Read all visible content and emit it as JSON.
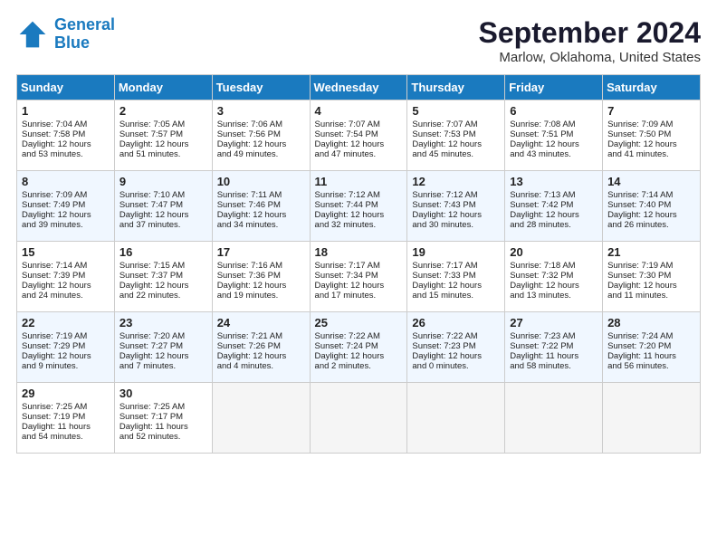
{
  "header": {
    "logo_line1": "General",
    "logo_line2": "Blue",
    "title": "September 2024",
    "subtitle": "Marlow, Oklahoma, United States"
  },
  "columns": [
    "Sunday",
    "Monday",
    "Tuesday",
    "Wednesday",
    "Thursday",
    "Friday",
    "Saturday"
  ],
  "weeks": [
    [
      {
        "day": "1",
        "info": "Sunrise: 7:04 AM\nSunset: 7:58 PM\nDaylight: 12 hours\nand 53 minutes."
      },
      {
        "day": "2",
        "info": "Sunrise: 7:05 AM\nSunset: 7:57 PM\nDaylight: 12 hours\nand 51 minutes."
      },
      {
        "day": "3",
        "info": "Sunrise: 7:06 AM\nSunset: 7:56 PM\nDaylight: 12 hours\nand 49 minutes."
      },
      {
        "day": "4",
        "info": "Sunrise: 7:07 AM\nSunset: 7:54 PM\nDaylight: 12 hours\nand 47 minutes."
      },
      {
        "day": "5",
        "info": "Sunrise: 7:07 AM\nSunset: 7:53 PM\nDaylight: 12 hours\nand 45 minutes."
      },
      {
        "day": "6",
        "info": "Sunrise: 7:08 AM\nSunset: 7:51 PM\nDaylight: 12 hours\nand 43 minutes."
      },
      {
        "day": "7",
        "info": "Sunrise: 7:09 AM\nSunset: 7:50 PM\nDaylight: 12 hours\nand 41 minutes."
      }
    ],
    [
      {
        "day": "8",
        "info": "Sunrise: 7:09 AM\nSunset: 7:49 PM\nDaylight: 12 hours\nand 39 minutes."
      },
      {
        "day": "9",
        "info": "Sunrise: 7:10 AM\nSunset: 7:47 PM\nDaylight: 12 hours\nand 37 minutes."
      },
      {
        "day": "10",
        "info": "Sunrise: 7:11 AM\nSunset: 7:46 PM\nDaylight: 12 hours\nand 34 minutes."
      },
      {
        "day": "11",
        "info": "Sunrise: 7:12 AM\nSunset: 7:44 PM\nDaylight: 12 hours\nand 32 minutes."
      },
      {
        "day": "12",
        "info": "Sunrise: 7:12 AM\nSunset: 7:43 PM\nDaylight: 12 hours\nand 30 minutes."
      },
      {
        "day": "13",
        "info": "Sunrise: 7:13 AM\nSunset: 7:42 PM\nDaylight: 12 hours\nand 28 minutes."
      },
      {
        "day": "14",
        "info": "Sunrise: 7:14 AM\nSunset: 7:40 PM\nDaylight: 12 hours\nand 26 minutes."
      }
    ],
    [
      {
        "day": "15",
        "info": "Sunrise: 7:14 AM\nSunset: 7:39 PM\nDaylight: 12 hours\nand 24 minutes."
      },
      {
        "day": "16",
        "info": "Sunrise: 7:15 AM\nSunset: 7:37 PM\nDaylight: 12 hours\nand 22 minutes."
      },
      {
        "day": "17",
        "info": "Sunrise: 7:16 AM\nSunset: 7:36 PM\nDaylight: 12 hours\nand 19 minutes."
      },
      {
        "day": "18",
        "info": "Sunrise: 7:17 AM\nSunset: 7:34 PM\nDaylight: 12 hours\nand 17 minutes."
      },
      {
        "day": "19",
        "info": "Sunrise: 7:17 AM\nSunset: 7:33 PM\nDaylight: 12 hours\nand 15 minutes."
      },
      {
        "day": "20",
        "info": "Sunrise: 7:18 AM\nSunset: 7:32 PM\nDaylight: 12 hours\nand 13 minutes."
      },
      {
        "day": "21",
        "info": "Sunrise: 7:19 AM\nSunset: 7:30 PM\nDaylight: 12 hours\nand 11 minutes."
      }
    ],
    [
      {
        "day": "22",
        "info": "Sunrise: 7:19 AM\nSunset: 7:29 PM\nDaylight: 12 hours\nand 9 minutes."
      },
      {
        "day": "23",
        "info": "Sunrise: 7:20 AM\nSunset: 7:27 PM\nDaylight: 12 hours\nand 7 minutes."
      },
      {
        "day": "24",
        "info": "Sunrise: 7:21 AM\nSunset: 7:26 PM\nDaylight: 12 hours\nand 4 minutes."
      },
      {
        "day": "25",
        "info": "Sunrise: 7:22 AM\nSunset: 7:24 PM\nDaylight: 12 hours\nand 2 minutes."
      },
      {
        "day": "26",
        "info": "Sunrise: 7:22 AM\nSunset: 7:23 PM\nDaylight: 12 hours\nand 0 minutes."
      },
      {
        "day": "27",
        "info": "Sunrise: 7:23 AM\nSunset: 7:22 PM\nDaylight: 11 hours\nand 58 minutes."
      },
      {
        "day": "28",
        "info": "Sunrise: 7:24 AM\nSunset: 7:20 PM\nDaylight: 11 hours\nand 56 minutes."
      }
    ],
    [
      {
        "day": "29",
        "info": "Sunrise: 7:25 AM\nSunset: 7:19 PM\nDaylight: 11 hours\nand 54 minutes."
      },
      {
        "day": "30",
        "info": "Sunrise: 7:25 AM\nSunset: 7:17 PM\nDaylight: 11 hours\nand 52 minutes."
      },
      {
        "day": "",
        "info": "",
        "empty": true
      },
      {
        "day": "",
        "info": "",
        "empty": true
      },
      {
        "day": "",
        "info": "",
        "empty": true
      },
      {
        "day": "",
        "info": "",
        "empty": true
      },
      {
        "day": "",
        "info": "",
        "empty": true
      }
    ]
  ]
}
